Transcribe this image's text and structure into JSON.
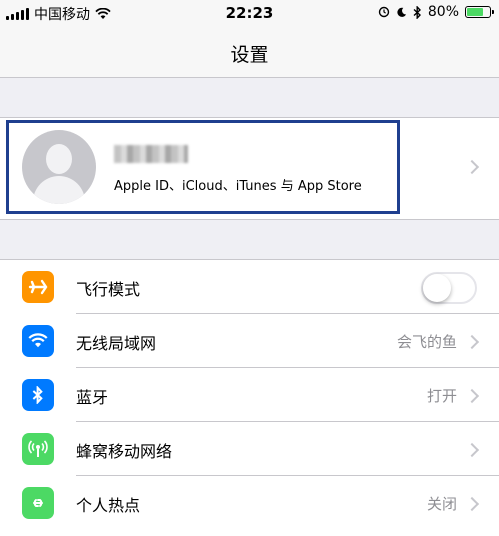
{
  "status_bar": {
    "carrier": "中国移动",
    "time": "22:23",
    "battery_percent": "80%",
    "battery_level": 0.8,
    "icons": [
      "signal-icon",
      "wifi-icon",
      "moon-icon",
      "alarm-icon",
      "bluetooth-icon",
      "battery-icon"
    ]
  },
  "nav": {
    "title": "设置"
  },
  "profile": {
    "name_blurred": true,
    "subtitle": "Apple ID、iCloud、iTunes 与 App Store",
    "highlight_color": "#1f3f8f"
  },
  "rows": [
    {
      "label": "飞行模式",
      "icon": "airplane-icon",
      "icon_color": "#ff9500",
      "control": "toggle",
      "toggle_on": false
    },
    {
      "label": "无线局域网",
      "icon": "wifi-icon",
      "icon_color": "#007aff",
      "value": "会飞的鱼"
    },
    {
      "label": "蓝牙",
      "icon": "bluetooth-icon",
      "icon_color": "#007aff",
      "value": "打开"
    },
    {
      "label": "蜂窝移动网络",
      "icon": "cellular-icon",
      "icon_color": "#4cd964"
    },
    {
      "label": "个人热点",
      "icon": "hotspot-icon",
      "icon_color": "#4cd964",
      "value": "关闭"
    }
  ]
}
